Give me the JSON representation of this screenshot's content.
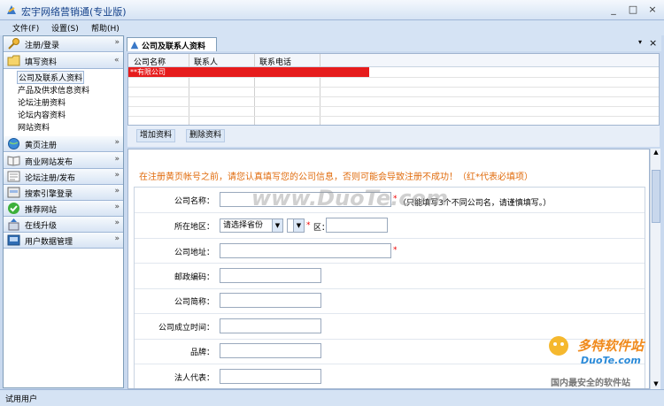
{
  "window": {
    "title": "宏宇网络营销通(专业版)",
    "minimize": "_",
    "maximize": "□",
    "close": "×"
  },
  "menu": [
    "文件(F)",
    "设置(S)",
    "帮助(H)"
  ],
  "sidebar": {
    "sections": [
      {
        "label": "注册/登录",
        "icon": "key-icon"
      },
      {
        "label": "填写资料",
        "icon": "folder-icon"
      }
    ],
    "subitems": [
      "公司及联系人资料",
      "产品及供求信息资料",
      "论坛注册资料",
      "论坛内容资料",
      "网站资料"
    ],
    "lower_sections": [
      {
        "label": "黄页注册",
        "icon": "globe-icon"
      },
      {
        "label": "商业网站发布",
        "icon": "book-icon"
      },
      {
        "label": "论坛注册/发布",
        "icon": "forum-icon"
      },
      {
        "label": "搜索引擎登录",
        "icon": "search-engine-icon"
      },
      {
        "label": "推荐网站",
        "icon": "check-icon"
      },
      {
        "label": "在线升级",
        "icon": "upgrade-icon"
      },
      {
        "label": "用户数据管理",
        "icon": "data-icon"
      }
    ],
    "chevron": "»"
  },
  "tab": {
    "label": "公司及联系人资料"
  },
  "grid": {
    "headers": [
      "公司名称",
      "联系人",
      "联系电话"
    ],
    "rows": [
      [
        "**有限公司",
        "",
        ""
      ]
    ]
  },
  "buttons": {
    "add": "增加资料",
    "delete": "删除资料"
  },
  "form": {
    "warning": "在注册黄页帐号之前，请您认真填写您的公司信息，否则可能会导致注册不成功！（红*代表必填项）",
    "company_name": "公司名称：",
    "company_name_hint": "（只能填写3个不同公司名，请谨慎填写。）",
    "region": "所在地区：",
    "province_select": "请选择省份",
    "district": "区：",
    "address": "公司地址：",
    "postcode": "邮政编码：",
    "short_name": "公司简称：",
    "founded": "公司成立时间：",
    "brand": "品牌：",
    "legal_rep": "法人代表：",
    "star": "*"
  },
  "watermark": {
    "text1": "www.DuoTe.com",
    "text2": "多特软件站",
    "text3": "DuoTe.com",
    "text4": "国内最安全的软件站"
  },
  "status": {
    "user": "试用用户"
  },
  "colors": {
    "accent_blue": "#15428b",
    "selected_row": "#e61c1c",
    "warning": "#e06b0c"
  }
}
